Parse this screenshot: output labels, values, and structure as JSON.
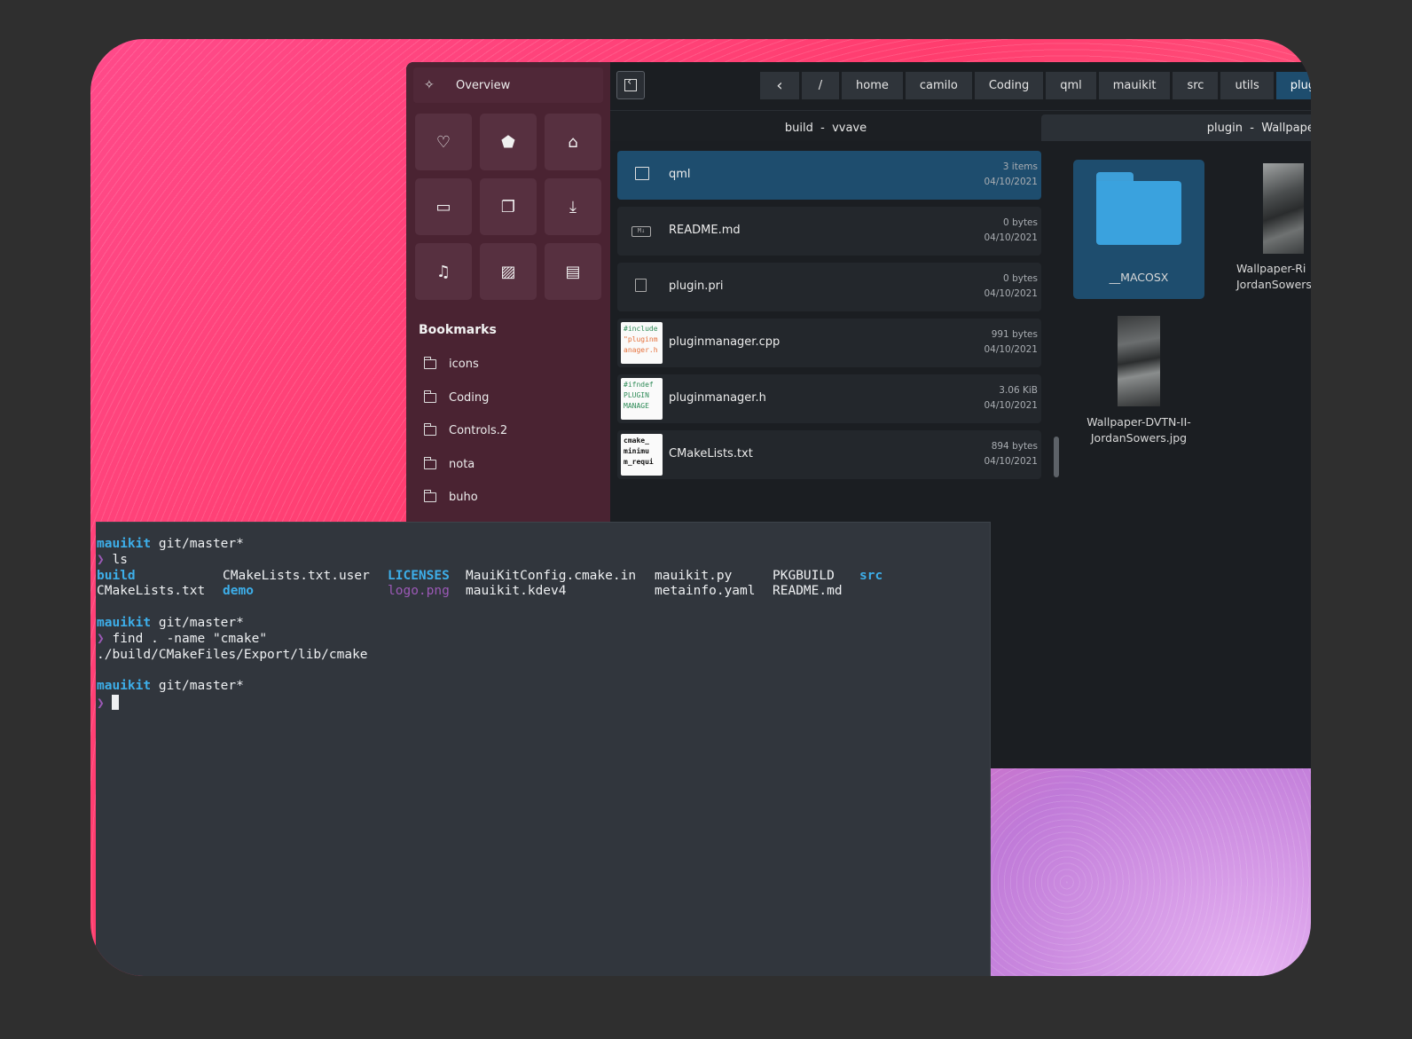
{
  "sidebar": {
    "overview_label": "Overview",
    "quick_icons": [
      "heart-icon",
      "tag-icon",
      "home-icon",
      "laptop-icon",
      "documents-icon",
      "download-icon",
      "music-icon",
      "image-icon",
      "film-icon"
    ],
    "bookmarks_title": "Bookmarks",
    "bookmarks": [
      "icons",
      "Coding",
      "Controls.2",
      "nota",
      "buho"
    ]
  },
  "breadcrumb": [
    "/",
    "home",
    "camilo",
    "Coding",
    "qml",
    "mauikit",
    "src",
    "utils",
    "plugin"
  ],
  "tabs": [
    {
      "left": "build",
      "right": "vvave"
    },
    {
      "left": "plugin",
      "right": "Wallpapers"
    }
  ],
  "tab_sep": "-",
  "files": [
    {
      "name": "qml",
      "size": "3 items",
      "date": "04/10/2021",
      "selected": true,
      "icon": "folder-icon"
    },
    {
      "name": "README.md",
      "size": "0 bytes",
      "date": "04/10/2021",
      "icon": "markdown-icon"
    },
    {
      "name": "plugin.pri",
      "size": "0 bytes",
      "date": "04/10/2021",
      "icon": "document-icon"
    },
    {
      "name": "pluginmanager.cpp",
      "size": "991 bytes",
      "date": "04/10/2021",
      "preview": [
        "#include",
        "\"pluginm",
        "anager.h"
      ]
    },
    {
      "name": "pluginmanager.h",
      "size": "3.06 KiB",
      "date": "04/10/2021",
      "preview": [
        "#ifndef",
        "PLUGIN",
        "MANAGE"
      ]
    },
    {
      "name": "CMakeLists.txt",
      "size": "894 bytes",
      "date": "04/10/2021",
      "preview": [
        "cmake_",
        "minimu",
        "m_requi"
      ]
    }
  ],
  "grid_items": [
    {
      "name": "__MACOSX"
    },
    {
      "name_line1": "Wallpaper-Ri",
      "name_line2": "JordanSowers"
    },
    {
      "name_line1": "Wallpaper-DVTN-II-",
      "name_line2": "JordanSowers.jpg"
    }
  ],
  "terminal": {
    "prompt_dir": "mauikit",
    "prompt_branch": "git/master*",
    "prompt_symbol": "❯",
    "cmd1": "ls",
    "ls_row1": [
      "build",
      "CMakeLists.txt.user",
      "LICENSES",
      "MauiKitConfig.cmake.in",
      "mauikit.py",
      "PKGBUILD",
      "src"
    ],
    "ls_row2": [
      "CMakeLists.txt",
      "demo",
      "logo.png",
      "mauikit.kdev4",
      "metainfo.yaml",
      "README.md"
    ],
    "cmd2": "find . -name \"cmake\"",
    "out2": "./build/CMakeFiles/Export/lib/cmake"
  },
  "colors": {
    "accent": "#3daee9",
    "selection": "#1e4d6e",
    "sidebar_bg": "#4a2332",
    "terminal_bg": "#31363d",
    "purple": "#9b59b6"
  }
}
